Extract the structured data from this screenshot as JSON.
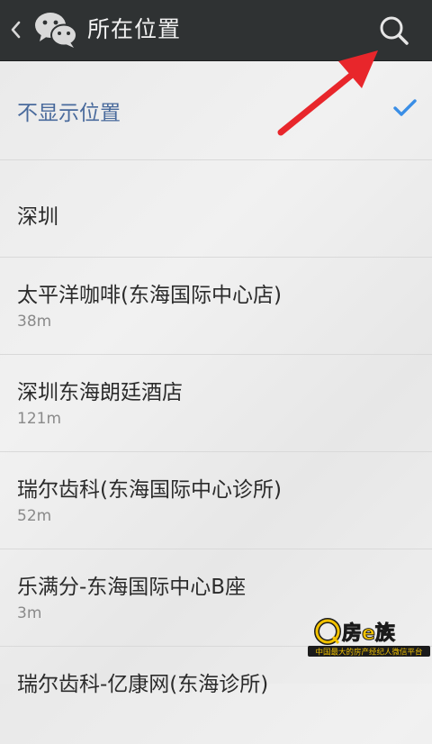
{
  "header": {
    "title": "所在位置",
    "icons": {
      "back": "chevron-left-icon",
      "app": "wechat-logo-icon",
      "search": "search-icon"
    }
  },
  "list": {
    "items": [
      {
        "name": "不显示位置",
        "distance": "",
        "selected": true
      },
      {
        "name": "深圳",
        "distance": ""
      },
      {
        "name": "太平洋咖啡(东海国际中心店)",
        "distance": "38m"
      },
      {
        "name": "深圳东海朗廷酒店",
        "distance": "121m"
      },
      {
        "name": "瑞尔齿科(东海国际中心诊所)",
        "distance": "52m"
      },
      {
        "name": "乐满分-东海国际中心B座",
        "distance": "3m"
      },
      {
        "name": "瑞尔齿科-亿康网(东海诊所)",
        "distance": ""
      }
    ]
  },
  "watermark": {
    "brand": "房e族",
    "slogan": "中国最大的房产经纪人微信平台"
  },
  "colors": {
    "topbar": "#2f3233",
    "accent": "#3a8ee6",
    "selected_text": "#496a9c",
    "arrow": "#e8262b"
  }
}
